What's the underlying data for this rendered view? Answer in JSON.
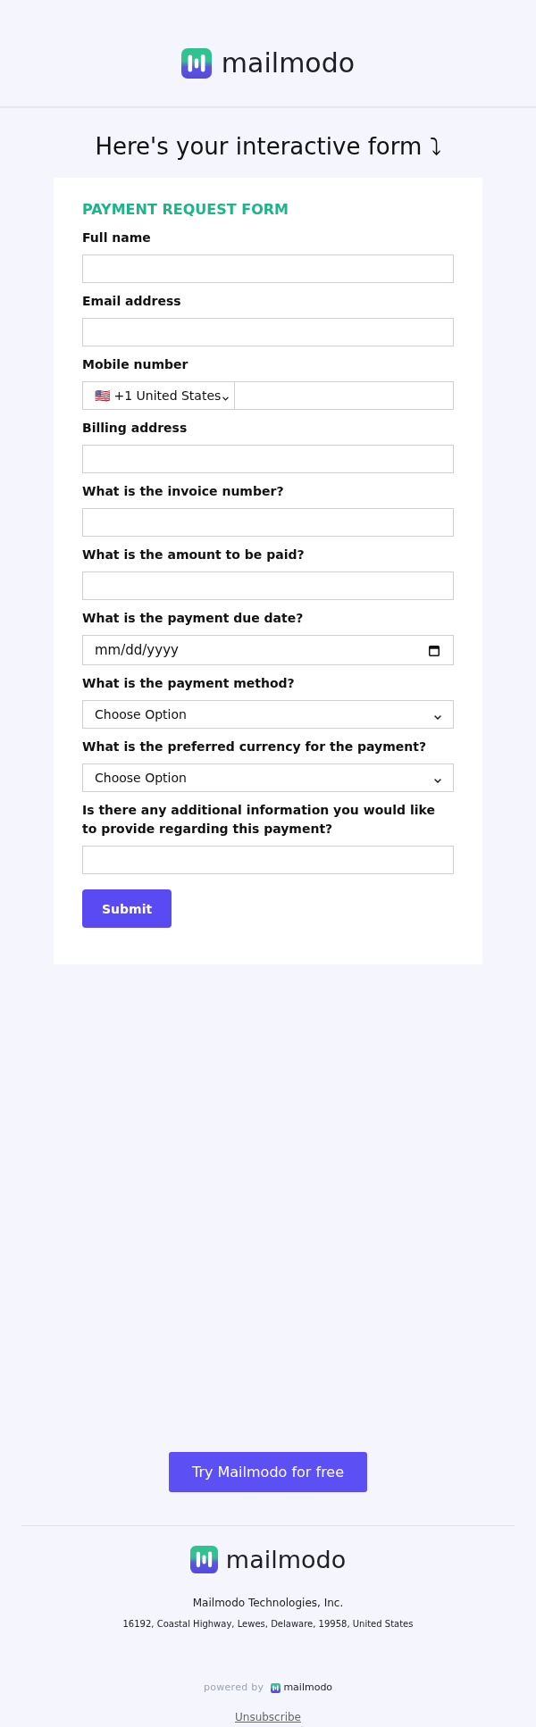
{
  "header": {
    "logo_text": "mailmodo"
  },
  "title": "Here's your interactive form ⤵",
  "form": {
    "heading": "PAYMENT REQUEST FORM",
    "fields": [
      {
        "kind": "text",
        "label": "Full name"
      },
      {
        "kind": "text",
        "label": "Email address"
      },
      {
        "kind": "phone",
        "label": "Mobile number",
        "country": "🇺🇸 +1 United States"
      },
      {
        "kind": "text",
        "label": "Billing address"
      },
      {
        "kind": "text",
        "label": "What is the invoice number?"
      },
      {
        "kind": "text",
        "label": "What is the amount to be paid?"
      },
      {
        "kind": "date",
        "label": "What is the payment due date?",
        "placeholder": "mm/dd/yyyy"
      },
      {
        "kind": "select",
        "label": "What is the payment method?",
        "value": "Choose Option"
      },
      {
        "kind": "select",
        "label": "What is the preferred currency for the payment?",
        "value": "Choose Option"
      },
      {
        "kind": "text",
        "label": "Is there any additional information you would like to provide regarding this payment?"
      }
    ],
    "submit": "Submit"
  },
  "cta": "Try Mailmodo for free",
  "footer": {
    "logo_text": "mailmodo",
    "company": "Mailmodo Technologies, Inc.",
    "address": "16192, Coastal Highway, Lewes, Delaware, 19958, United States",
    "powered_by": "powered by",
    "powered_logo_text": "mailmodo",
    "unsubscribe": "Unsubscribe"
  }
}
